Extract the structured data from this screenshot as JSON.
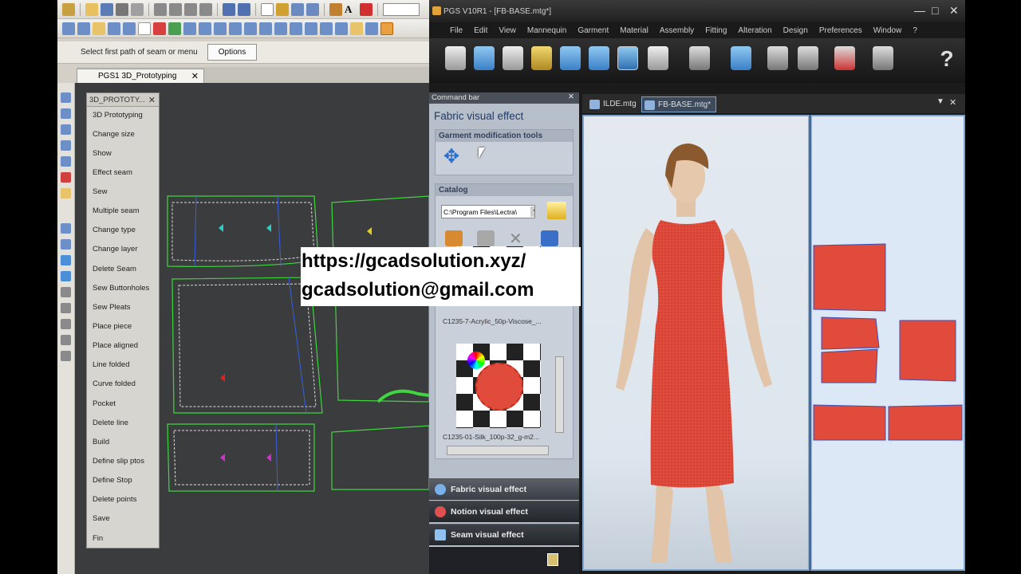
{
  "left_app": {
    "prompt": "Select first path of seam or menu",
    "options_button": "Options",
    "doc_tab": "PGS1   3D_Prototyping",
    "close_glyph": "✕",
    "panel_title": "3D_PROTOTY...",
    "commands": [
      "3D Prototyping",
      "Change size",
      "Show",
      "Effect seam",
      "Sew",
      "Multiple seam",
      "Change type",
      "Change layer",
      "Delete Seam",
      "Sew Buttonholes",
      "Sew Pleats",
      "Place piece",
      "Place aligned",
      "Line folded",
      "Curve folded",
      "Pocket",
      "Delete line",
      "Build",
      "Define slip ptos",
      "Define Stop",
      "Delete points",
      "Save",
      "Fin"
    ]
  },
  "right_app": {
    "title": "PGS V10R1 - [FB-BASE.mtg*]",
    "window_buttons": [
      "—",
      "□",
      "✕"
    ],
    "menu": [
      "File",
      "Edit",
      "View",
      "Mannequin",
      "Garment",
      "Material",
      "Assembly",
      "Fitting",
      "Alteration",
      "Design",
      "Preferences",
      "Window",
      "?"
    ],
    "command_bar": {
      "header": "Command bar",
      "close_glyph": "✕",
      "section_title": "Fabric visual effect",
      "garment_group": "Garment modification tools",
      "catalog_group": "Catalog",
      "catalog_path": "C:\\Program Files\\Lectra\\",
      "fabric_1": "C1235-7-Acrylic_50p-Viscose_...",
      "fabric_2": "C1235-01-Silk_100p-32_g-m2...",
      "effects": [
        "Fabric visual effect",
        "Notion visual effect",
        "Seam visual effect"
      ]
    },
    "view_tabs": [
      "ILDE.mtg",
      "FB-BASE.mtg*"
    ],
    "dress_color": "#e14b3b"
  },
  "watermark": {
    "url": "https://gcadsolution.xyz/",
    "email": "gcadsolution@gmail.com"
  }
}
